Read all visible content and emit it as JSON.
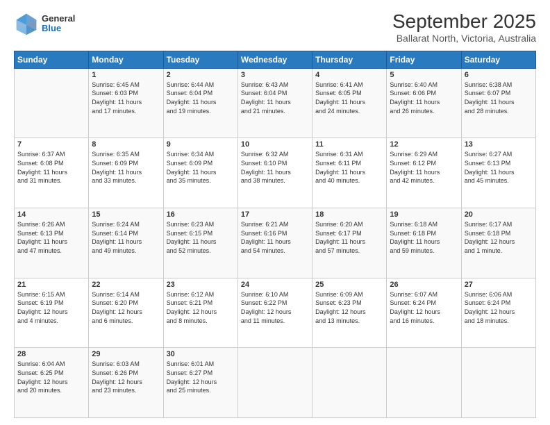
{
  "header": {
    "logo": {
      "general": "General",
      "blue": "Blue"
    },
    "title": "September 2025",
    "subtitle": "Ballarat North, Victoria, Australia"
  },
  "calendar": {
    "days": [
      "Sunday",
      "Monday",
      "Tuesday",
      "Wednesday",
      "Thursday",
      "Friday",
      "Saturday"
    ],
    "weeks": [
      [
        {
          "day": "",
          "data": ""
        },
        {
          "day": "1",
          "data": "Sunrise: 6:45 AM\nSunset: 6:03 PM\nDaylight: 11 hours\nand 17 minutes."
        },
        {
          "day": "2",
          "data": "Sunrise: 6:44 AM\nSunset: 6:04 PM\nDaylight: 11 hours\nand 19 minutes."
        },
        {
          "day": "3",
          "data": "Sunrise: 6:43 AM\nSunset: 6:04 PM\nDaylight: 11 hours\nand 21 minutes."
        },
        {
          "day": "4",
          "data": "Sunrise: 6:41 AM\nSunset: 6:05 PM\nDaylight: 11 hours\nand 24 minutes."
        },
        {
          "day": "5",
          "data": "Sunrise: 6:40 AM\nSunset: 6:06 PM\nDaylight: 11 hours\nand 26 minutes."
        },
        {
          "day": "6",
          "data": "Sunrise: 6:38 AM\nSunset: 6:07 PM\nDaylight: 11 hours\nand 28 minutes."
        }
      ],
      [
        {
          "day": "7",
          "data": "Sunrise: 6:37 AM\nSunset: 6:08 PM\nDaylight: 11 hours\nand 31 minutes."
        },
        {
          "day": "8",
          "data": "Sunrise: 6:35 AM\nSunset: 6:09 PM\nDaylight: 11 hours\nand 33 minutes."
        },
        {
          "day": "9",
          "data": "Sunrise: 6:34 AM\nSunset: 6:09 PM\nDaylight: 11 hours\nand 35 minutes."
        },
        {
          "day": "10",
          "data": "Sunrise: 6:32 AM\nSunset: 6:10 PM\nDaylight: 11 hours\nand 38 minutes."
        },
        {
          "day": "11",
          "data": "Sunrise: 6:31 AM\nSunset: 6:11 PM\nDaylight: 11 hours\nand 40 minutes."
        },
        {
          "day": "12",
          "data": "Sunrise: 6:29 AM\nSunset: 6:12 PM\nDaylight: 11 hours\nand 42 minutes."
        },
        {
          "day": "13",
          "data": "Sunrise: 6:27 AM\nSunset: 6:13 PM\nDaylight: 11 hours\nand 45 minutes."
        }
      ],
      [
        {
          "day": "14",
          "data": "Sunrise: 6:26 AM\nSunset: 6:13 PM\nDaylight: 11 hours\nand 47 minutes."
        },
        {
          "day": "15",
          "data": "Sunrise: 6:24 AM\nSunset: 6:14 PM\nDaylight: 11 hours\nand 49 minutes."
        },
        {
          "day": "16",
          "data": "Sunrise: 6:23 AM\nSunset: 6:15 PM\nDaylight: 11 hours\nand 52 minutes."
        },
        {
          "day": "17",
          "data": "Sunrise: 6:21 AM\nSunset: 6:16 PM\nDaylight: 11 hours\nand 54 minutes."
        },
        {
          "day": "18",
          "data": "Sunrise: 6:20 AM\nSunset: 6:17 PM\nDaylight: 11 hours\nand 57 minutes."
        },
        {
          "day": "19",
          "data": "Sunrise: 6:18 AM\nSunset: 6:18 PM\nDaylight: 11 hours\nand 59 minutes."
        },
        {
          "day": "20",
          "data": "Sunrise: 6:17 AM\nSunset: 6:18 PM\nDaylight: 12 hours\nand 1 minute."
        }
      ],
      [
        {
          "day": "21",
          "data": "Sunrise: 6:15 AM\nSunset: 6:19 PM\nDaylight: 12 hours\nand 4 minutes."
        },
        {
          "day": "22",
          "data": "Sunrise: 6:14 AM\nSunset: 6:20 PM\nDaylight: 12 hours\nand 6 minutes."
        },
        {
          "day": "23",
          "data": "Sunrise: 6:12 AM\nSunset: 6:21 PM\nDaylight: 12 hours\nand 8 minutes."
        },
        {
          "day": "24",
          "data": "Sunrise: 6:10 AM\nSunset: 6:22 PM\nDaylight: 12 hours\nand 11 minutes."
        },
        {
          "day": "25",
          "data": "Sunrise: 6:09 AM\nSunset: 6:23 PM\nDaylight: 12 hours\nand 13 minutes."
        },
        {
          "day": "26",
          "data": "Sunrise: 6:07 AM\nSunset: 6:24 PM\nDaylight: 12 hours\nand 16 minutes."
        },
        {
          "day": "27",
          "data": "Sunrise: 6:06 AM\nSunset: 6:24 PM\nDaylight: 12 hours\nand 18 minutes."
        }
      ],
      [
        {
          "day": "28",
          "data": "Sunrise: 6:04 AM\nSunset: 6:25 PM\nDaylight: 12 hours\nand 20 minutes."
        },
        {
          "day": "29",
          "data": "Sunrise: 6:03 AM\nSunset: 6:26 PM\nDaylight: 12 hours\nand 23 minutes."
        },
        {
          "day": "30",
          "data": "Sunrise: 6:01 AM\nSunset: 6:27 PM\nDaylight: 12 hours\nand 25 minutes."
        },
        {
          "day": "",
          "data": ""
        },
        {
          "day": "",
          "data": ""
        },
        {
          "day": "",
          "data": ""
        },
        {
          "day": "",
          "data": ""
        }
      ]
    ]
  }
}
